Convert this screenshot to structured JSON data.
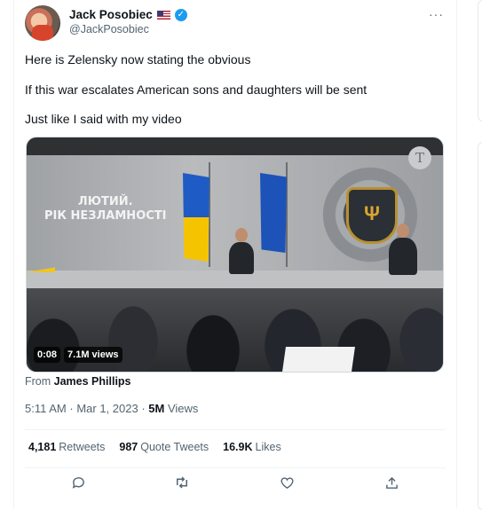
{
  "tweet": {
    "author_name": "Jack Posobiec",
    "author_handle": "@JackPosobiec",
    "verified_icon": "verified-badge-icon",
    "flag_icon": "us-flag-icon",
    "more_label": "···",
    "lines": [
      "Here is Zelensky now stating the obvious",
      "If this war escalates American sons and daughters will be sent",
      "Just like I said with my video"
    ],
    "video": {
      "duration": "0:08",
      "views": "7.1M views",
      "sign_line1": "ЛЮТИЙ.",
      "sign_line2": "РІК НЕЗЛАМНОСТІ",
      "publisher_mark": "T"
    },
    "from_prefix": "From",
    "from_name": "James Phillips",
    "time": "5:11 AM",
    "date": "Mar 1, 2023",
    "separator": "·",
    "views_count": "5M",
    "views_label": "Views",
    "stats": [
      {
        "count": "4,181",
        "label": "Retweets"
      },
      {
        "count": "987",
        "label": "Quote Tweets"
      },
      {
        "count": "16.9K",
        "label": "Likes"
      }
    ],
    "actions": [
      "reply-icon",
      "retweet-icon",
      "like-icon",
      "share-icon"
    ],
    "colors": {
      "accent": "#1d9bf0",
      "muted": "#536471",
      "text": "#0f1419",
      "border": "#eff3f4"
    }
  }
}
